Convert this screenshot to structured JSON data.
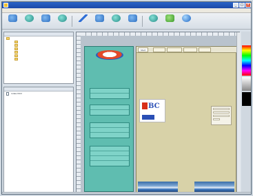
{
  "window": {
    "title": ""
  },
  "menu": [],
  "toolbar": [
    {
      "icon": "new-icon",
      "label": ""
    },
    {
      "icon": "open-icon",
      "label": ""
    },
    {
      "icon": "layout-icon",
      "label": ""
    },
    {
      "icon": "properties-icon",
      "label": ""
    },
    {
      "icon": "link-icon",
      "label": ""
    },
    {
      "icon": "image-icon",
      "label": ""
    },
    {
      "icon": "table-icon",
      "label": ""
    },
    {
      "icon": "form-icon",
      "label": ""
    },
    {
      "icon": "preview-icon",
      "label": ""
    },
    {
      "icon": "publish-icon",
      "label": ""
    },
    {
      "icon": "help-icon",
      "label": ""
    }
  ],
  "site_tree": {
    "items": [
      "",
      "",
      "",
      "",
      "",
      "",
      ""
    ]
  },
  "files": {
    "items": [
      "index.html"
    ]
  },
  "nav_page": {
    "groups": [
      [
        "",
        ""
      ],
      [
        "",
        ""
      ],
      [
        "",
        "",
        ""
      ],
      [
        "",
        "",
        "",
        ""
      ]
    ]
  },
  "web_page": {
    "tabs": [
      "Start",
      "",
      "",
      "",
      ""
    ],
    "headline": "",
    "ad_brand": "BC",
    "body_items": [
      "",
      "",
      "",
      "",
      "",
      "",
      "",
      "",
      "",
      "",
      "",
      "",
      "",
      "",
      "",
      "",
      "",
      "",
      "",
      ""
    ]
  },
  "colors": {
    "title_bar": "#1a48a8",
    "nav_background": "#5fbdb0",
    "page_background": "#d8d2a8",
    "headline_text": "#2c3f8c"
  }
}
